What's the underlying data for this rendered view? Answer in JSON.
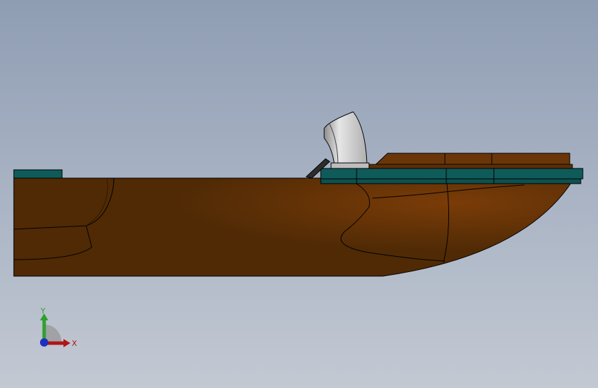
{
  "viewport": {
    "background_top": "#8f9db3",
    "background_bottom": "#c3c9d3"
  },
  "model": {
    "hull_color": "#4f2a05",
    "hull_highlight": "#6e3a0c",
    "deck_trim_color": "#0f5b5a",
    "seat_color": "#cfcfcf",
    "edge_color": "#000000"
  },
  "triad": {
    "y_label": "Y",
    "x_label": "X",
    "y_color": "#2ea02e",
    "x_color": "#b01515",
    "z_color": "#1f2fbf"
  }
}
